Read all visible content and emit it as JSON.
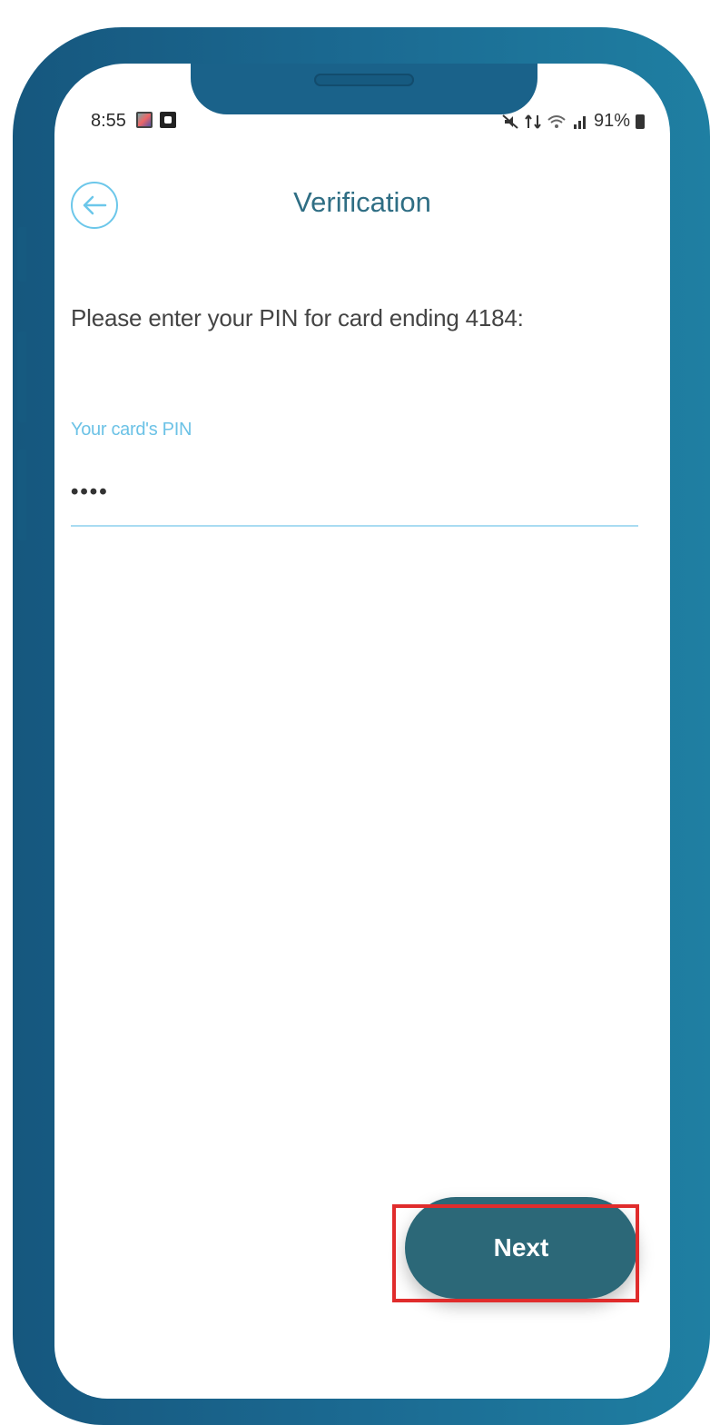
{
  "status_bar": {
    "time": "8:55",
    "battery": "91%"
  },
  "header": {
    "title": "Verification"
  },
  "form": {
    "prompt": "Please enter your PIN for card ending 4184:",
    "pin_label": "Your card's PIN",
    "pin_value": "••••"
  },
  "actions": {
    "next_label": "Next"
  },
  "colors": {
    "accent": "#6cc2e6",
    "button": "#2c6878",
    "highlight": "#e02c2c",
    "title": "#2f6e84"
  }
}
